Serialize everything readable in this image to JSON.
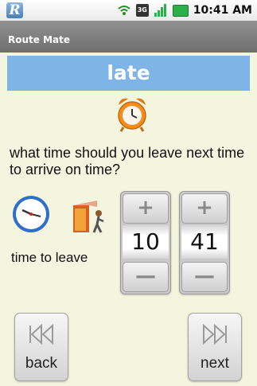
{
  "status_bar": {
    "app_icon_letter": "R",
    "network_label": "3G",
    "time": "10:41 AM"
  },
  "app": {
    "title": "Route Mate"
  },
  "banner": {
    "text": "late"
  },
  "question": "what time should you leave next time to arrive on time?",
  "time_label": "time to leave",
  "picker": {
    "plus": "+",
    "minus": "—",
    "hour": "10",
    "minute": "41"
  },
  "nav": {
    "back_label": "back",
    "next_label": "next"
  },
  "colors": {
    "background": "#f3f5df",
    "banner": "#7fb4e6",
    "titlebar": "#7d7d7d",
    "accent": "#f28c1c"
  },
  "icons": [
    "app-icon",
    "wifi-icon",
    "3g-icon",
    "signal-icon",
    "battery-icon",
    "alarm-clock-icon",
    "clock-icon",
    "walk-icon",
    "skip-back-icon",
    "skip-forward-icon"
  ]
}
